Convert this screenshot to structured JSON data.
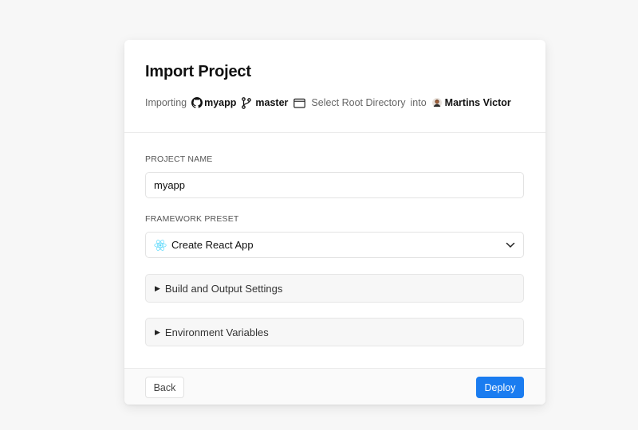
{
  "dialog": {
    "title": "Import Project",
    "import_line": {
      "prefix": "Importing",
      "repo_icon": "github-icon",
      "repo_name": "myapp",
      "branch_icon": "git-branch-icon",
      "branch_name": "master",
      "folder_icon": "folder-icon",
      "root_directory_link": "Select Root Directory",
      "into": "into",
      "user_avatar": "avatar",
      "user_name": "Martins Victor"
    }
  },
  "form": {
    "project_name_label": "PROJECT NAME",
    "project_name_value": "myapp",
    "framework_label": "FRAMEWORK PRESET",
    "framework_icon": "react-icon",
    "framework_value": "Create React App",
    "framework_dropdown_icon": "chevron-down-icon",
    "build_settings_label": "Build and Output Settings",
    "env_vars_label": "Environment Variables",
    "expand_icon": "triangle-right-icon"
  },
  "footer": {
    "back_label": "Back",
    "deploy_label": "Deploy"
  },
  "colors": {
    "accent": "#1a7cf0",
    "background": "#f7f7f7",
    "card": "#ffffff",
    "react_blue": "#61dafb"
  }
}
